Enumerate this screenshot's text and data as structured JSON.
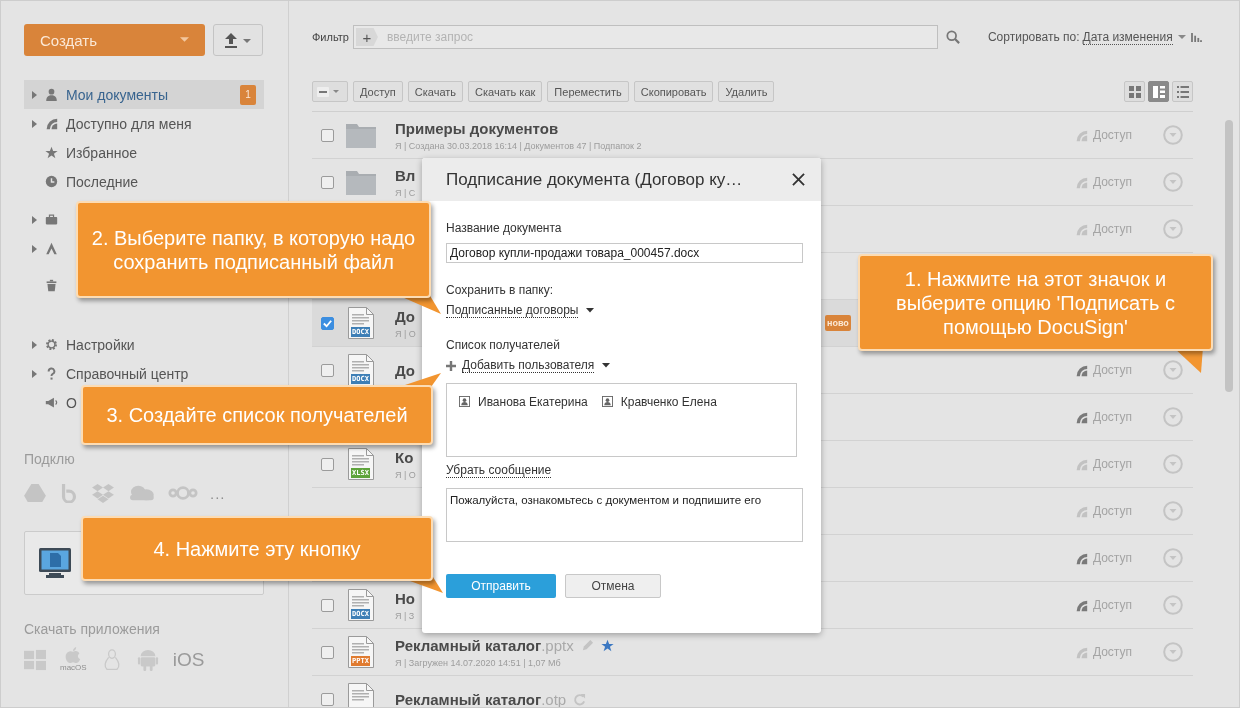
{
  "sidebar": {
    "create_button": "Создать",
    "groups": [
      [
        {
          "label": "Мои документы",
          "has_children": true,
          "selected": true,
          "badge": "1"
        },
        {
          "label": "Доступно для меня",
          "has_children": true,
          "selected": false
        },
        {
          "label": "Избранное",
          "has_children": false,
          "selected": false
        },
        {
          "label": "Последние",
          "has_children": false,
          "selected": false
        }
      ],
      [
        {
          "has_children": true,
          "selected": false
        },
        {
          "has_children": true,
          "selected": false
        },
        {
          "has_children": false,
          "selected": false
        }
      ],
      [
        {
          "label": "Настройки",
          "has_children": true,
          "selected": false
        },
        {
          "label": "Справочный центр",
          "has_children": true,
          "selected": false
        },
        {
          "label": "О",
          "has_children": false,
          "selected": false
        }
      ]
    ],
    "connect_label": "Подклю",
    "connect_more": "...",
    "apps_label": "Скачать приложения",
    "macos_label": "macOS",
    "ios_label": "iOS"
  },
  "filter": {
    "label": "Фильтр",
    "tag": "+",
    "placeholder": "введите запрос"
  },
  "sort": {
    "label": "Сортировать по:",
    "value": "Дата изменения"
  },
  "toolbar": [
    "Доступ",
    "Скачать",
    "Скачать как",
    "Переместить",
    "Скопировать",
    "Удалить"
  ],
  "view_modes": [
    {
      "selected": false
    },
    {
      "selected": true
    },
    {
      "selected": false
    }
  ],
  "rows": [
    {
      "kind": "folder",
      "checked": false,
      "title": "Примеры документов",
      "meta": "Я | Создана 30.03.2018 16:14 | Документов 47 | Подпапок 2",
      "access": "Доступ",
      "shared": false
    },
    {
      "kind": "folder",
      "checked": false,
      "title": "Вл",
      "meta": "Я | С",
      "access": "Доступ",
      "shared": false
    },
    {
      "access": "Доступ",
      "shared": false
    },
    {
      "kind": "docx",
      "type_label": "DOCX",
      "checked": true,
      "title": "До",
      "meta": "Я | О",
      "badge": "ново"
    },
    {
      "kind": "docx",
      "type_label": "DOCX",
      "checked": false,
      "title": "До",
      "access": "Доступ",
      "shared": true
    },
    {
      "access": "Доступ",
      "shared": true
    },
    {
      "kind": "xlsx",
      "type_label": "XLSX",
      "checked": false,
      "title": "Ко",
      "meta": "Я | О",
      "access": "Доступ",
      "shared": false
    },
    {
      "access": "Доступ",
      "shared": false
    },
    {
      "access": "Доступ",
      "shared": true
    },
    {
      "kind": "docx",
      "type_label": "DOCX",
      "checked": false,
      "title": "Но",
      "meta": "Я | З",
      "access": "Доступ",
      "shared": true
    },
    {
      "kind": "pptx",
      "type_label": "PPTX",
      "checked": false,
      "title": "Рекламный каталог",
      "ext": ".pptx",
      "editing": true,
      "favorite": true,
      "meta": "Я | Загружен 14.07.2020 14:51 | 1,07 Мб",
      "access": "Доступ",
      "shared": false
    },
    {
      "kind": "doc",
      "checked": false,
      "title": "Рекламный каталог",
      "ext": ".otp",
      "syncing": true
    }
  ],
  "dialog": {
    "title": "Подписание документа (Договор ку…",
    "name_label": "Название документа",
    "name_value": "Договор купли-продажи товара_000457.docx",
    "folder_label": "Сохранить в папку:",
    "folder_value": "Подписанные договоры",
    "recipients_label": "Список получателей",
    "add_user": "Добавить пользователя",
    "recipients": [
      "Иванова Екатерина",
      "Кравченко Елена"
    ],
    "message_toggle": "Убрать сообщение",
    "message": "Пожалуйста, ознакомьтесь с документом и подпишите его",
    "buttons": [
      {
        "label": "Отправить",
        "kind": "primary"
      },
      {
        "label": "Отмена",
        "kind": "secondary"
      }
    ]
  },
  "callouts": [
    {
      "text": "1. Нажмите на этот значок и выберите опцию 'Подписать с помощью DocuSign'"
    },
    {
      "text": "2. Выберите папку, в которую надо сохранить подписанный файл"
    },
    {
      "text": "3. Создайте список получателей"
    },
    {
      "text": "4. Нажмите эту кнопку"
    }
  ]
}
